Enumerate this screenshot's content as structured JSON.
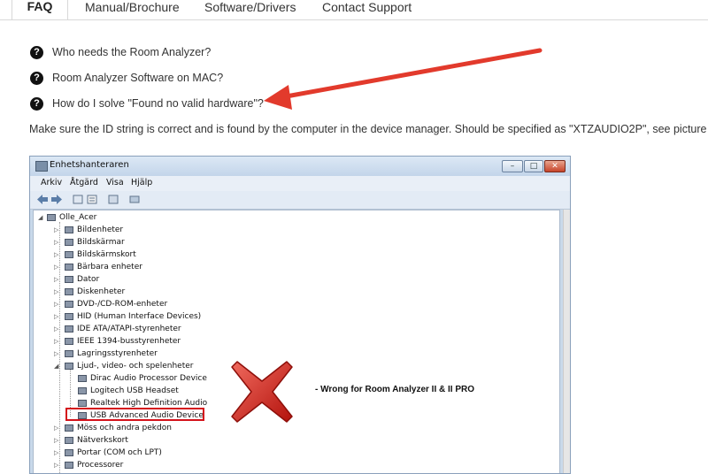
{
  "tabs": {
    "active": "FAQ",
    "items": [
      "Manual/Brochure",
      "Software/Drivers",
      "Contact Support"
    ]
  },
  "faq": {
    "icon": "question-circle-icon",
    "items": [
      "Who needs the Room Analyzer?",
      "Room Analyzer Software on MAC?",
      "How do I solve \"Found no valid hardware\"?"
    ],
    "answer": "Make sure the ID string is correct and is found by the computer in the device manager. Should be specified as \"XTZAUDIO2P\", see picture below."
  },
  "screenshot": {
    "window_title": "Enhetshanteraren",
    "menu": [
      "Arkiv",
      "Åtgärd",
      "Visa",
      "Hjälp"
    ],
    "root": "Olle_Acer",
    "nodes": [
      "Bildenheter",
      "Bildskärmar",
      "Bildskärmskort",
      "Bärbara enheter",
      "Dator",
      "Diskenheter",
      "DVD-/CD-ROM-enheter",
      "HID (Human Interface Devices)",
      "IDE ATA/ATAPI-styrenheter",
      "IEEE 1394-busstyrenheter",
      "Lagringsstyrenheter",
      "Ljud-, video- och spelenheter"
    ],
    "audio_children": [
      "Dirac Audio Processor Device",
      "Logitech USB Headset",
      "Realtek High Definition Audio",
      "USB Advanced Audio Device"
    ],
    "after_nodes": [
      "Möss och andra pekdon",
      "Nätverkskort",
      "Portar (COM och LPT)",
      "Processorer"
    ],
    "annotation": "- Wrong for Room Analyzer II & II PRO",
    "highlight_color": "#d4121a",
    "arrow_color": "#e23a2c"
  }
}
